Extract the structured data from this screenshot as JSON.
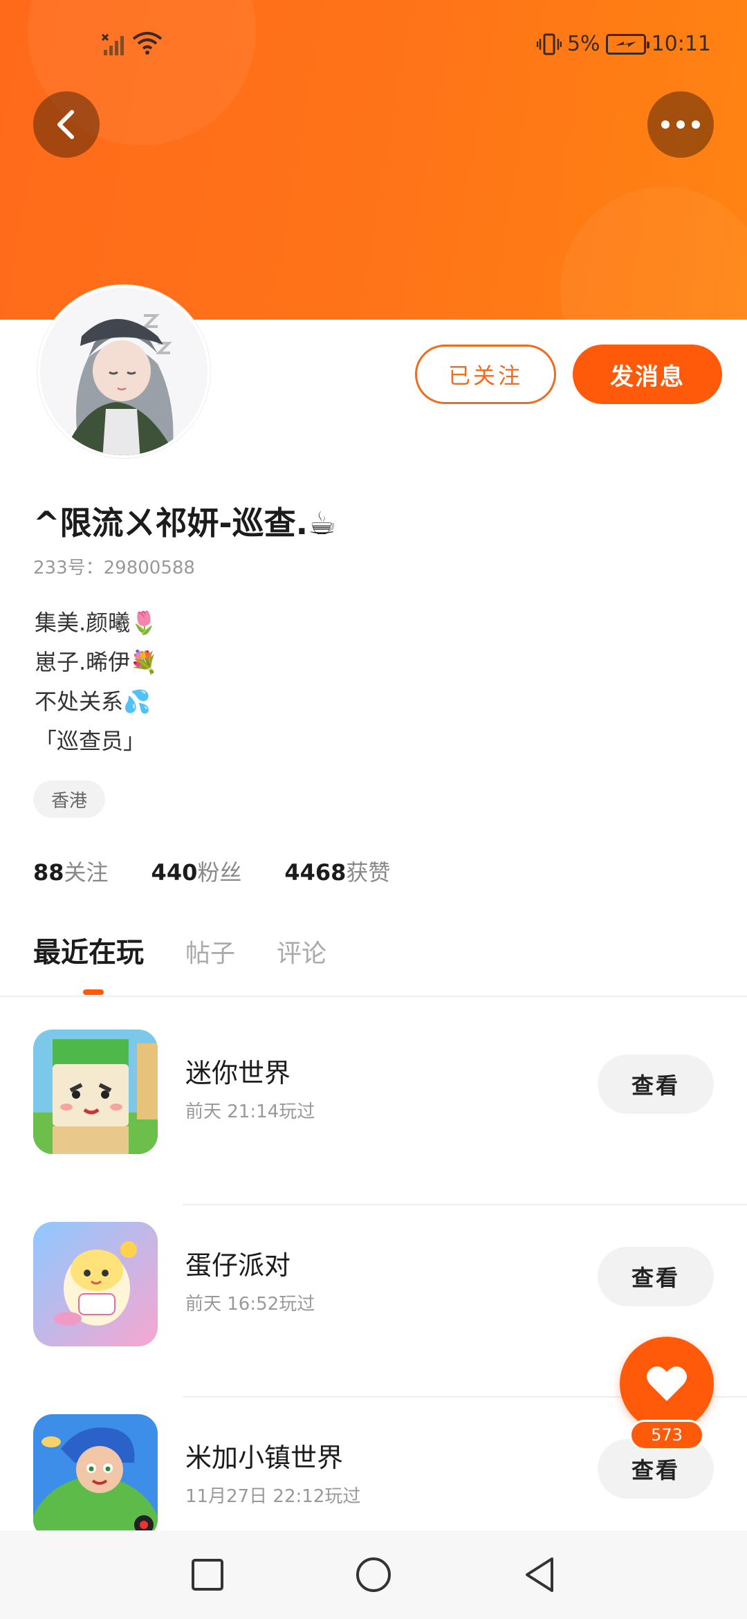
{
  "status_bar": {
    "battery": "5%",
    "time": "10:11"
  },
  "profile": {
    "nickname": "^限流ㄨ祁妍-巡查.☕",
    "uid_label": "233号：",
    "uid": "29800588",
    "bio_lines": [
      "集美.颜曦🌷",
      "崽子.晞伊💐",
      "不处关系💦",
      "「巡查员」"
    ],
    "location": "香港",
    "follow_button": "已关注",
    "message_button": "发消息"
  },
  "stats": {
    "following_count": "88",
    "following_label": "关注",
    "fans_count": "440",
    "fans_label": "粉丝",
    "likes_count": "4468",
    "likes_label": "获赞"
  },
  "tabs": [
    "最近在玩",
    "帖子",
    "评论"
  ],
  "games": [
    {
      "name": "迷你世界",
      "time": "前天 21:14玩过",
      "button": "查看",
      "icon": "mini-world-icon"
    },
    {
      "name": "蛋仔派对",
      "time": "前天 16:52玩过",
      "button": "查看",
      "icon": "eggy-party-icon"
    },
    {
      "name": "米加小镇世界",
      "time": "11月27日 22:12玩过",
      "button": "查看",
      "icon": "toca-town-icon"
    }
  ],
  "like_fab": {
    "count": "573"
  },
  "colors": {
    "accent": "#ff5a0a",
    "banner": "#ff7418"
  }
}
